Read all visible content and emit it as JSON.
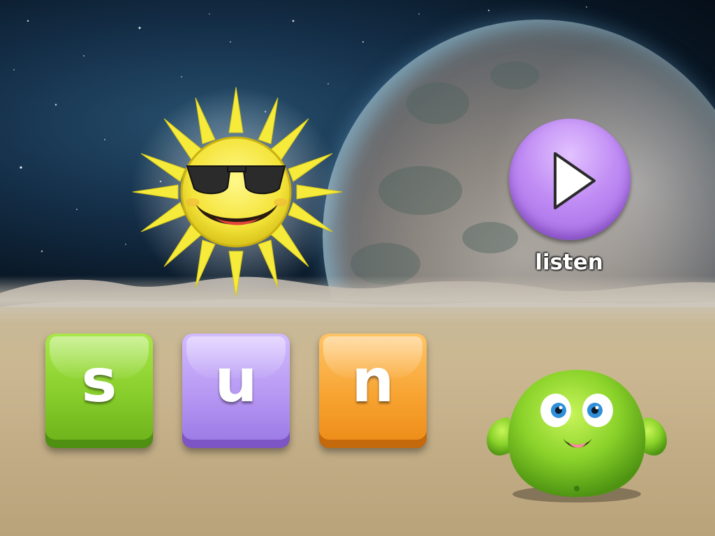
{
  "scene": {
    "sky_color": "#15304a",
    "ground_color": "#c7b897",
    "planet_color": "#8c8680"
  },
  "word": {
    "letters": [
      "s",
      "u",
      "n"
    ],
    "tile_colors": [
      "#86cc2a",
      "#b596f2",
      "#f7a331"
    ]
  },
  "listen_button": {
    "label": "listen",
    "icon": "play-icon",
    "color": "#b98af0"
  },
  "picture": {
    "icon": "sun-with-sunglasses"
  },
  "mascot": {
    "icon": "green-blob-creature",
    "color": "#8ad22a"
  }
}
